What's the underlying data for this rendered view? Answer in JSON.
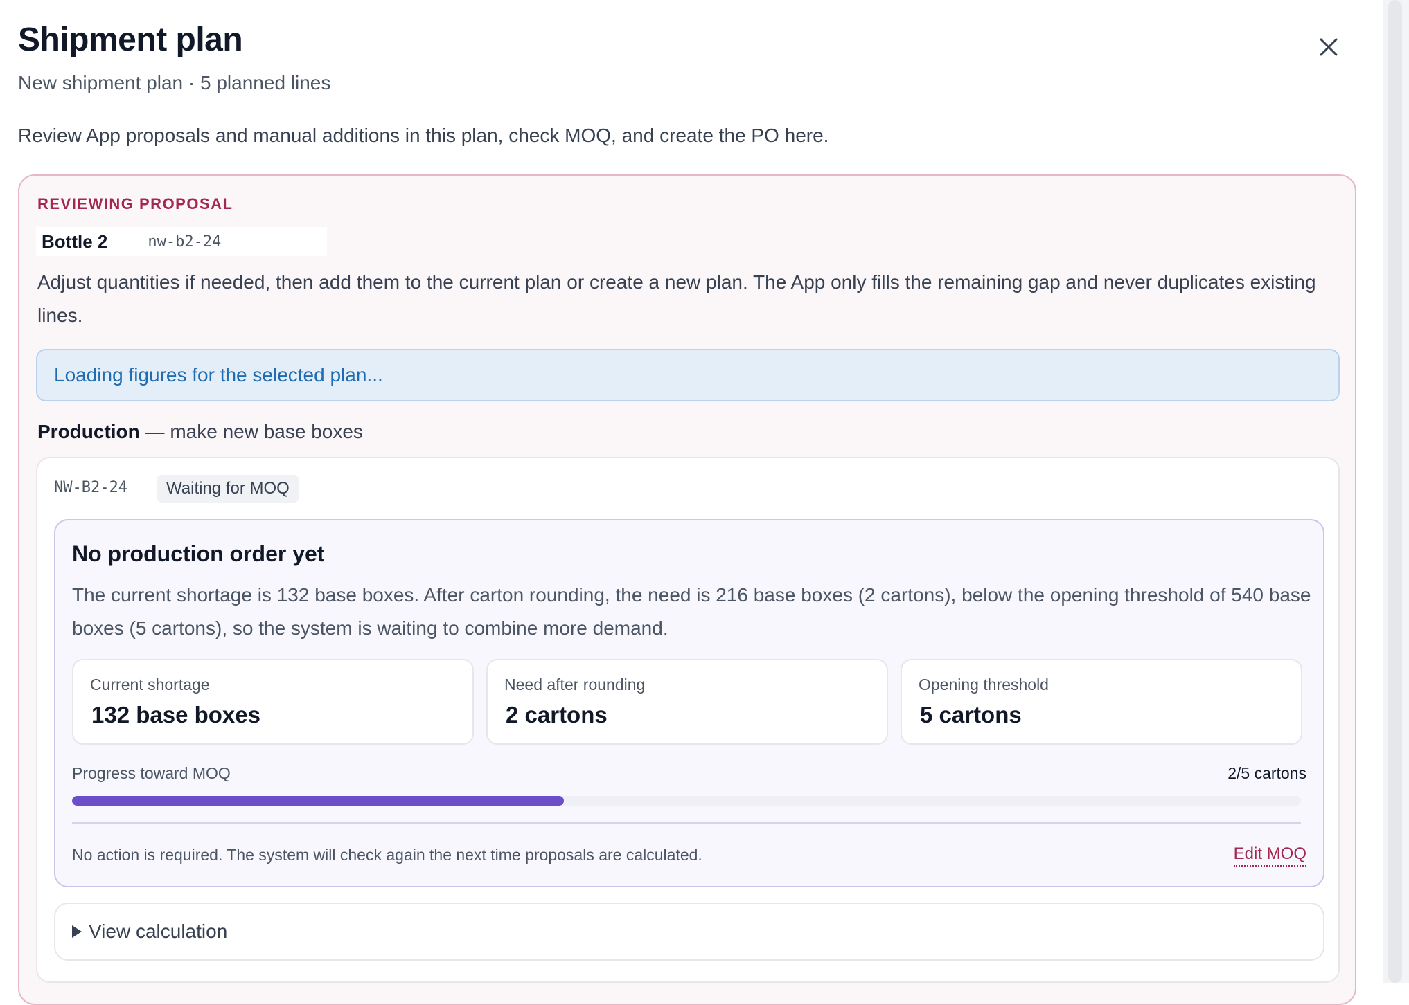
{
  "header": {
    "title": "Shipment plan",
    "subtitle": "New shipment plan · 5 planned lines",
    "close_icon": "close-icon"
  },
  "intro": "Review App proposals and manual additions in this plan, check MOQ, and create the PO here.",
  "proposal": {
    "eyebrow": "REVIEWING PROPOSAL",
    "product_name": "Bottle 2",
    "product_sku": "nw-b2-24",
    "description": "Adjust quantities if needed, then add them to the current plan or create a new plan. The App only fills the remaining gap and never duplicates existing lines.",
    "loading_text": "Loading figures for the selected plan...",
    "section_heading_strong": "Production",
    "section_heading_rest": " — make new base boxes"
  },
  "production": {
    "sku": "NW-B2-24",
    "status": "Waiting for MOQ",
    "moq": {
      "title": "No production order yet",
      "description": "The current shortage is 132 base boxes. After carton rounding, the need is 216 base boxes (2 cartons), below the opening threshold of 540 base boxes (5 cartons), so the system is waiting to combine more demand.",
      "stats": [
        {
          "label": "Current shortage",
          "value": "132 base boxes"
        },
        {
          "label": "Need after rounding",
          "value": "2 cartons"
        },
        {
          "label": "Opening threshold",
          "value": "5 cartons"
        }
      ],
      "progress_label": "Progress toward MOQ",
      "progress_count": "2/5 cartons",
      "progress_fraction": 0.4,
      "progress_color": "#6b4fc8",
      "note": "No action is required. The system will check again the next time proposals are calculated.",
      "edit_label": "Edit MOQ"
    },
    "view_calc_label": "View calculation"
  },
  "colors": {
    "accent": "#a3284f",
    "info": "#1f6cb3"
  }
}
